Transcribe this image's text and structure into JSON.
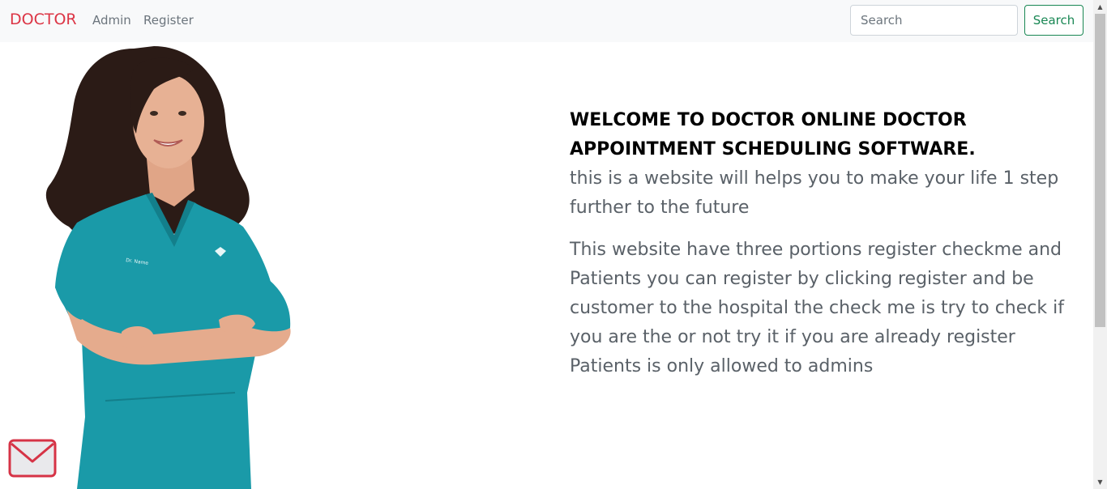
{
  "navbar": {
    "brand": "DOCTOR",
    "links": [
      {
        "label": "Admin"
      },
      {
        "label": "Register"
      }
    ],
    "search": {
      "placeholder": "Search",
      "value": "",
      "button_label": "Search"
    }
  },
  "main": {
    "headline": "WELCOME TO DOCTOR ONLINE DOCTOR APPOINTMENT SCHEDULING SOFTWARE.",
    "tagline": "this is a website will helps you to make your life 1 step further to the future",
    "description": "This website have three portions register checkme and Patients you can register by clicking register and be customer to the hospital the check me is try to check if you are the or not try it if you are already register Patients is only allowed to admins"
  },
  "icons": {
    "mail": "mail-icon"
  },
  "colors": {
    "brand": "#dc3545",
    "nav_link": "#6c757d",
    "search_button": "#198754",
    "navbar_bg": "#f8f9fa",
    "scrubs": "#1a9aa8"
  }
}
